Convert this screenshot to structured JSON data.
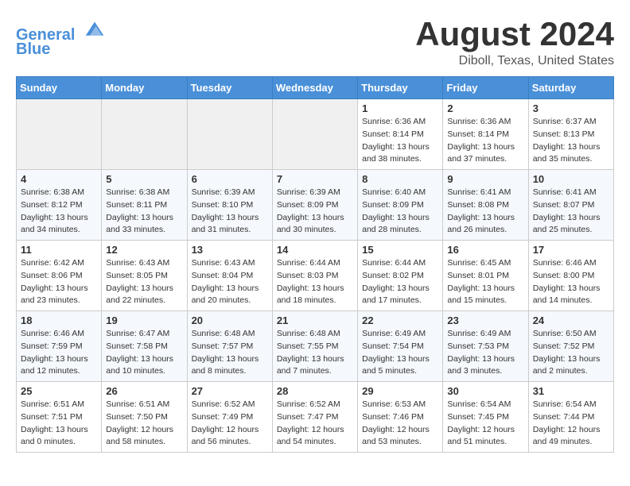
{
  "header": {
    "logo_line1": "General",
    "logo_line2": "Blue",
    "month_year": "August 2024",
    "location": "Diboll, Texas, United States"
  },
  "days_of_week": [
    "Sunday",
    "Monday",
    "Tuesday",
    "Wednesday",
    "Thursday",
    "Friday",
    "Saturday"
  ],
  "weeks": [
    [
      {
        "day": "",
        "info": ""
      },
      {
        "day": "",
        "info": ""
      },
      {
        "day": "",
        "info": ""
      },
      {
        "day": "",
        "info": ""
      },
      {
        "day": "1",
        "info": "Sunrise: 6:36 AM\nSunset: 8:14 PM\nDaylight: 13 hours\nand 38 minutes."
      },
      {
        "day": "2",
        "info": "Sunrise: 6:36 AM\nSunset: 8:14 PM\nDaylight: 13 hours\nand 37 minutes."
      },
      {
        "day": "3",
        "info": "Sunrise: 6:37 AM\nSunset: 8:13 PM\nDaylight: 13 hours\nand 35 minutes."
      }
    ],
    [
      {
        "day": "4",
        "info": "Sunrise: 6:38 AM\nSunset: 8:12 PM\nDaylight: 13 hours\nand 34 minutes."
      },
      {
        "day": "5",
        "info": "Sunrise: 6:38 AM\nSunset: 8:11 PM\nDaylight: 13 hours\nand 33 minutes."
      },
      {
        "day": "6",
        "info": "Sunrise: 6:39 AM\nSunset: 8:10 PM\nDaylight: 13 hours\nand 31 minutes."
      },
      {
        "day": "7",
        "info": "Sunrise: 6:39 AM\nSunset: 8:09 PM\nDaylight: 13 hours\nand 30 minutes."
      },
      {
        "day": "8",
        "info": "Sunrise: 6:40 AM\nSunset: 8:09 PM\nDaylight: 13 hours\nand 28 minutes."
      },
      {
        "day": "9",
        "info": "Sunrise: 6:41 AM\nSunset: 8:08 PM\nDaylight: 13 hours\nand 26 minutes."
      },
      {
        "day": "10",
        "info": "Sunrise: 6:41 AM\nSunset: 8:07 PM\nDaylight: 13 hours\nand 25 minutes."
      }
    ],
    [
      {
        "day": "11",
        "info": "Sunrise: 6:42 AM\nSunset: 8:06 PM\nDaylight: 13 hours\nand 23 minutes."
      },
      {
        "day": "12",
        "info": "Sunrise: 6:43 AM\nSunset: 8:05 PM\nDaylight: 13 hours\nand 22 minutes."
      },
      {
        "day": "13",
        "info": "Sunrise: 6:43 AM\nSunset: 8:04 PM\nDaylight: 13 hours\nand 20 minutes."
      },
      {
        "day": "14",
        "info": "Sunrise: 6:44 AM\nSunset: 8:03 PM\nDaylight: 13 hours\nand 18 minutes."
      },
      {
        "day": "15",
        "info": "Sunrise: 6:44 AM\nSunset: 8:02 PM\nDaylight: 13 hours\nand 17 minutes."
      },
      {
        "day": "16",
        "info": "Sunrise: 6:45 AM\nSunset: 8:01 PM\nDaylight: 13 hours\nand 15 minutes."
      },
      {
        "day": "17",
        "info": "Sunrise: 6:46 AM\nSunset: 8:00 PM\nDaylight: 13 hours\nand 14 minutes."
      }
    ],
    [
      {
        "day": "18",
        "info": "Sunrise: 6:46 AM\nSunset: 7:59 PM\nDaylight: 13 hours\nand 12 minutes."
      },
      {
        "day": "19",
        "info": "Sunrise: 6:47 AM\nSunset: 7:58 PM\nDaylight: 13 hours\nand 10 minutes."
      },
      {
        "day": "20",
        "info": "Sunrise: 6:48 AM\nSunset: 7:57 PM\nDaylight: 13 hours\nand 8 minutes."
      },
      {
        "day": "21",
        "info": "Sunrise: 6:48 AM\nSunset: 7:55 PM\nDaylight: 13 hours\nand 7 minutes."
      },
      {
        "day": "22",
        "info": "Sunrise: 6:49 AM\nSunset: 7:54 PM\nDaylight: 13 hours\nand 5 minutes."
      },
      {
        "day": "23",
        "info": "Sunrise: 6:49 AM\nSunset: 7:53 PM\nDaylight: 13 hours\nand 3 minutes."
      },
      {
        "day": "24",
        "info": "Sunrise: 6:50 AM\nSunset: 7:52 PM\nDaylight: 13 hours\nand 2 minutes."
      }
    ],
    [
      {
        "day": "25",
        "info": "Sunrise: 6:51 AM\nSunset: 7:51 PM\nDaylight: 13 hours\nand 0 minutes."
      },
      {
        "day": "26",
        "info": "Sunrise: 6:51 AM\nSunset: 7:50 PM\nDaylight: 12 hours\nand 58 minutes."
      },
      {
        "day": "27",
        "info": "Sunrise: 6:52 AM\nSunset: 7:49 PM\nDaylight: 12 hours\nand 56 minutes."
      },
      {
        "day": "28",
        "info": "Sunrise: 6:52 AM\nSunset: 7:47 PM\nDaylight: 12 hours\nand 54 minutes."
      },
      {
        "day": "29",
        "info": "Sunrise: 6:53 AM\nSunset: 7:46 PM\nDaylight: 12 hours\nand 53 minutes."
      },
      {
        "day": "30",
        "info": "Sunrise: 6:54 AM\nSunset: 7:45 PM\nDaylight: 12 hours\nand 51 minutes."
      },
      {
        "day": "31",
        "info": "Sunrise: 6:54 AM\nSunset: 7:44 PM\nDaylight: 12 hours\nand 49 minutes."
      }
    ]
  ],
  "accent_color": "#4a90d9"
}
